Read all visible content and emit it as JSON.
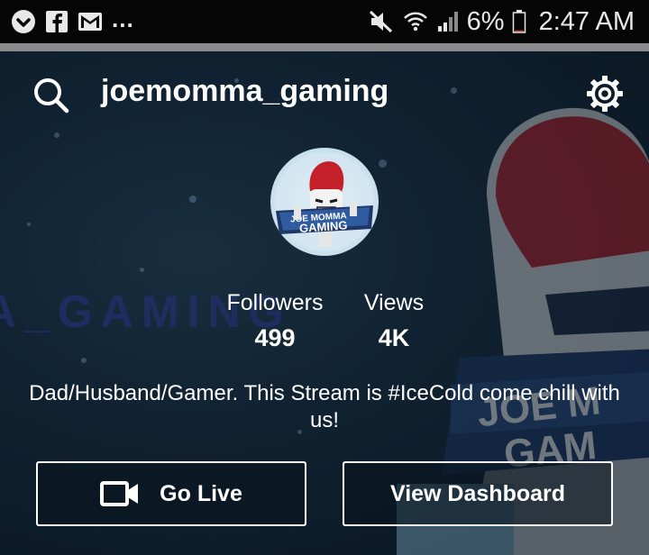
{
  "status_bar": {
    "notification_icons": [
      "pocket-icon",
      "facebook-icon",
      "gmail-icon"
    ],
    "overflow": "...",
    "system_icons": [
      "mute-icon",
      "wifi-icon",
      "signal-icon"
    ],
    "battery_percent": "6%",
    "battery_level": 0.06,
    "time": "2:47 AM"
  },
  "profile": {
    "channel_name": "joemomma_gaming",
    "banner_text": "A_GAMING",
    "avatar_logo_text": [
      "JOE MOMMA",
      "GAMING"
    ],
    "background_mascot_text": [
      "JOE M",
      "GAM"
    ],
    "stats": {
      "followers_label": "Followers",
      "followers_value": "499",
      "views_label": "Views",
      "views_value": "4K"
    },
    "bio": "Dad/Husband/Gamer. This Stream is #IceCold come chill with us!"
  },
  "actions": {
    "go_live_label": "Go Live",
    "view_dashboard_label": "View Dashboard"
  },
  "colors": {
    "background": "#14283a",
    "text": "#ffffff",
    "mascot_red": "#c4202a",
    "banner_text": "#2c3c8a"
  }
}
